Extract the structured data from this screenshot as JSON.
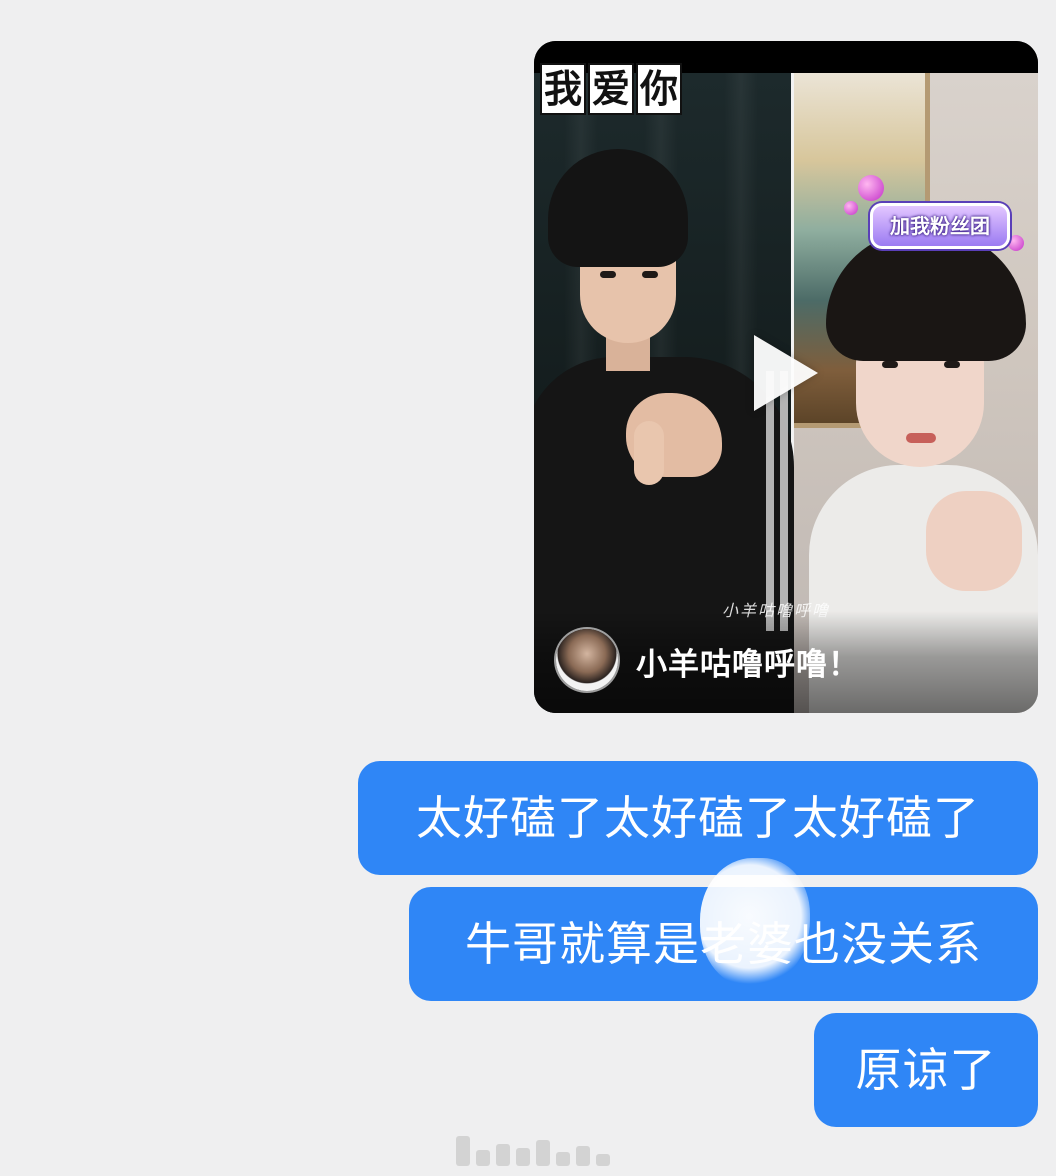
{
  "video_card": {
    "sticker_chars": [
      "我",
      "爱",
      "你"
    ],
    "fan_club_sticker": "加我粉丝团",
    "watermark": "小羊咕噜呼噜",
    "caption": "小羊咕噜呼噜！",
    "play_icon": "play-triangle-icon"
  },
  "messages": [
    {
      "text": "太好磕了太好磕了太好磕了"
    },
    {
      "text": "牛哥就算是老婆也没关系"
    },
    {
      "text": "原谅了"
    }
  ],
  "colors": {
    "background": "#efeff0",
    "bubble": "#2f86f6",
    "bubble_text": "#ffffff"
  }
}
